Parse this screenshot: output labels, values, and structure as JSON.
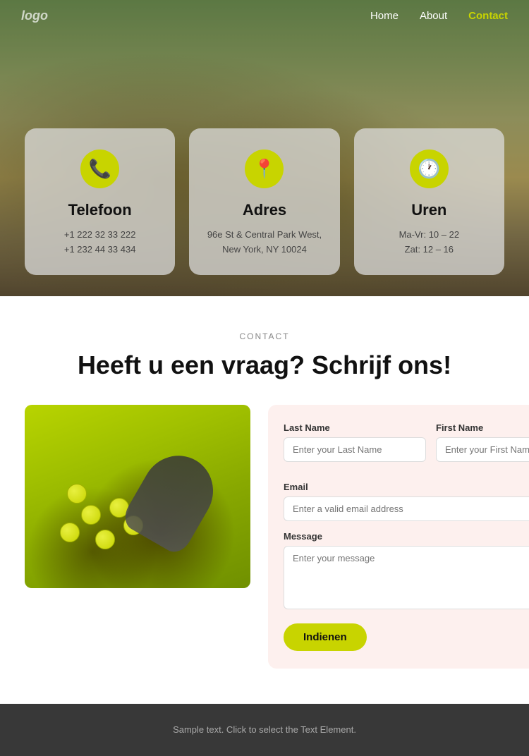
{
  "nav": {
    "logo": "logo",
    "links": [
      {
        "id": "home",
        "label": "Home",
        "active": false
      },
      {
        "id": "about",
        "label": "About",
        "active": false
      },
      {
        "id": "contact",
        "label": "Contact",
        "active": true
      }
    ]
  },
  "cards": [
    {
      "id": "telefoon",
      "icon": "📞",
      "title": "Telefoon",
      "lines": [
        "+1 222 32 33 222",
        "+1 232 44 33 434"
      ]
    },
    {
      "id": "adres",
      "icon": "📍",
      "title": "Adres",
      "lines": [
        "96e St & Central Park West,",
        "New York, NY 10024"
      ]
    },
    {
      "id": "uren",
      "icon": "🕐",
      "title": "Uren",
      "lines": [
        "Ma-Vr: 10 – 22",
        "Zat: 12 – 16"
      ]
    }
  ],
  "contact": {
    "label": "CONTACT",
    "heading": "Heeft u een vraag? Schrijf ons!",
    "form": {
      "last_name_label": "Last Name",
      "last_name_placeholder": "Enter your Last Name",
      "first_name_label": "First Name",
      "first_name_placeholder": "Enter your First Name",
      "email_label": "Email",
      "email_placeholder": "Enter a valid email address",
      "message_label": "Message",
      "message_placeholder": "Enter your message",
      "submit_label": "Indienen"
    }
  },
  "footer": {
    "text": "Sample text. Click to select the Text Element."
  }
}
